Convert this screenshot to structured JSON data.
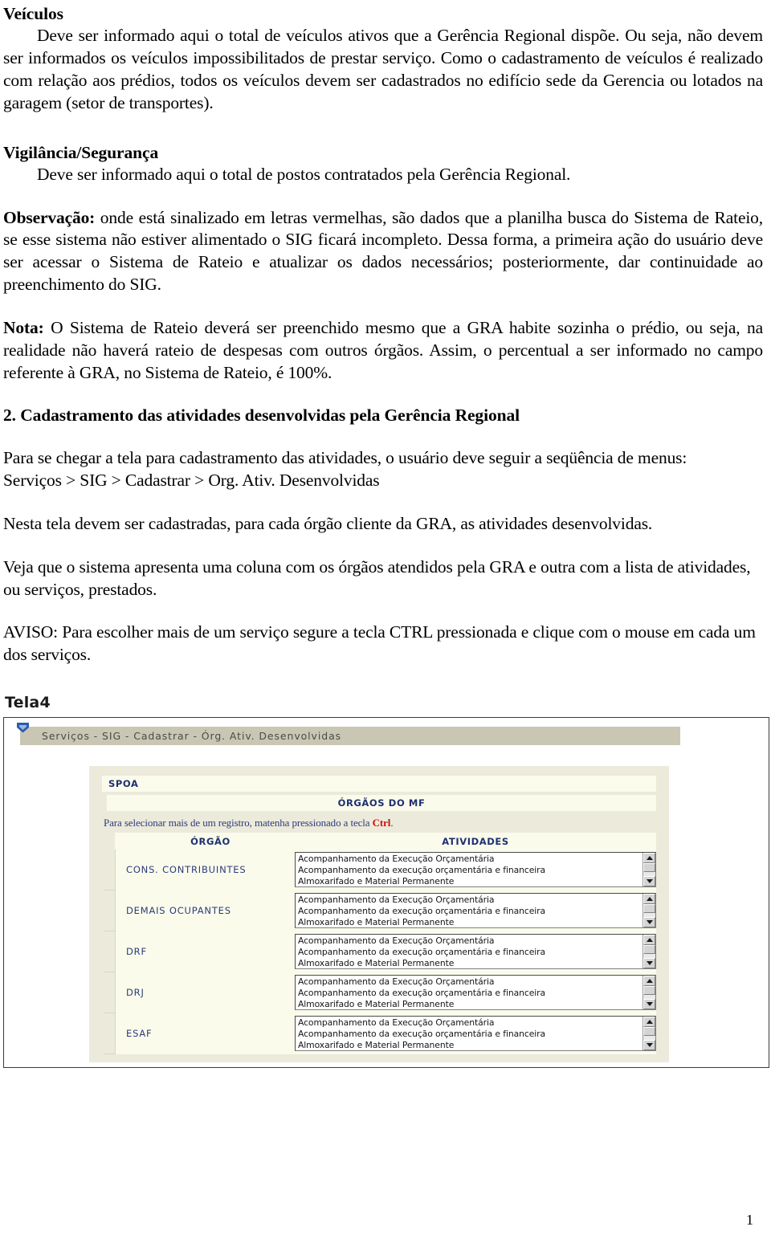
{
  "document": {
    "sections": [
      {
        "heading": "Veículos",
        "paragraphs": [
          "Deve ser informado aqui o total de veículos ativos que a Gerência Regional dispõe. Ou seja, não devem ser informados os veículos impossibilitados de prestar serviço. Como o cadastramento de veículos é realizado com relação aos prédios, todos os veículos devem ser cadastrados no edifício sede da Gerencia ou lotados na garagem (setor de transportes)."
        ]
      },
      {
        "heading": "Vigilância/Segurança",
        "paragraphs": [
          "Deve ser informado aqui o total de postos contratados pela Gerência Regional."
        ]
      }
    ],
    "observacao": {
      "label": "Observação:",
      "text": " onde está sinalizado em letras vermelhas, são dados que a planilha busca do Sistema de Rateio, se esse sistema não estiver alimentado o SIG ficará incompleto. Dessa forma, a primeira ação do usuário deve ser acessar o Sistema de Rateio e atualizar os dados necessários; posteriormente, dar continuidade ao preenchimento do SIG."
    },
    "nota": {
      "label": "Nota:",
      "text": " O Sistema de Rateio deverá ser preenchido mesmo que a GRA habite sozinha o prédio, ou seja, na realidade não haverá rateio de despesas com outros órgãos. Assim, o percentual a ser informado no campo referente à GRA, no Sistema de Rateio, é 100%."
    },
    "numbered_heading": "2. Cadastramento das atividades desenvolvidas pela Gerência Regional",
    "body_paragraphs": [
      "Para se chegar a tela para cadastramento das atividades, o usuário deve seguir a seqüência de menus:",
      "Serviços > SIG > Cadastrar > Org. Ativ. Desenvolvidas",
      "Nesta tela devem ser cadastradas, para cada órgão cliente da GRA, as atividades desenvolvidas.",
      "Veja que o sistema apresenta uma coluna com os órgãos atendidos pela GRA e outra com a lista de atividades, ou serviços, prestados.",
      "AVISO: Para escolher mais de um serviço segure a tecla CTRL pressionada e clique com o mouse em cada um dos serviços."
    ],
    "figure_caption": "Tela4",
    "page_number": "1"
  },
  "screenshot": {
    "titlebar": {
      "text": "Serviços - SIG - Cadastrar - Órg. Ativ. Desenvolvidas",
      "icon": "blue-banner-icon",
      "bg_color": "#c9c7b4"
    },
    "panel": {
      "unit_label": "SPOA",
      "group_header": "ÓRGÃOS DO MF",
      "hint_prefix": "Para selecionar mais de um registro, matenha pressionado a tecla ",
      "hint_key": "Ctrl",
      "hint_suffix": ".",
      "hint_key_color": "#cc1111",
      "columns": {
        "organ": "ÓRGÃO",
        "activities": "ATIVIDADES"
      },
      "activity_options": [
        "Acompanhamento da Execução Orçamentária",
        "Acompanhamento da execução orçamentária e financeira",
        "Almoxarifado e Material Permanente"
      ],
      "rows": [
        {
          "organ": "CONS. CONTRIBUINTES"
        },
        {
          "organ": "DEMAIS OCUPANTES"
        },
        {
          "organ": "DRF"
        },
        {
          "organ": "DRJ"
        },
        {
          "organ": "ESAF"
        }
      ],
      "bg_color": "#eceadb",
      "cell_color": "#fbfbec",
      "text_color": "#2b3c7a"
    }
  }
}
